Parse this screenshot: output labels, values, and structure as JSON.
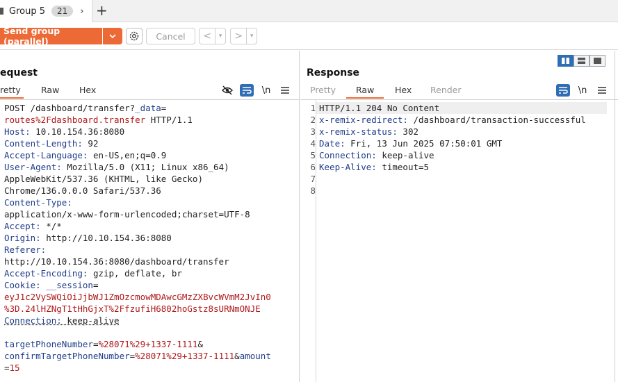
{
  "tabbar": {
    "tab_label": "Group 5",
    "tab_count": "21",
    "chevron": "›",
    "add": "+"
  },
  "toolbar": {
    "send_label": "Send group (parallel)",
    "send_dropdown": "⌄",
    "cancel_label": "Cancel",
    "prev": "<",
    "next": ">",
    "dropdown_glyph": "▾"
  },
  "request": {
    "title": "equest",
    "tabs": [
      "retty",
      "Raw",
      "Hex"
    ],
    "icons": [
      "eye-off-icon",
      "wrap-icon",
      "newline-icon",
      "menu-icon"
    ],
    "newline_label": "\\n",
    "lines": [
      [
        {
          "c": "v",
          "t": "POST /dashboard/transfer?"
        },
        {
          "c": "k",
          "t": "_data"
        },
        {
          "c": "v",
          "t": "="
        }
      ],
      [
        {
          "c": "red",
          "t": "routes%2Fdashboard.transfer"
        },
        {
          "c": "v",
          "t": " HTTP/1.1"
        }
      ],
      [
        {
          "c": "k",
          "t": "Host:"
        },
        {
          "c": "v",
          "t": " 10.10.154.36:8080"
        }
      ],
      [
        {
          "c": "k",
          "t": "Content-Length:"
        },
        {
          "c": "v",
          "t": " 92"
        }
      ],
      [
        {
          "c": "k",
          "t": "Accept-Language:"
        },
        {
          "c": "v",
          "t": " en-US,en;q=0.9"
        }
      ],
      [
        {
          "c": "k",
          "t": "User-Agent:"
        },
        {
          "c": "v",
          "t": " Mozilla/5.0 (X11; Linux x86_64)"
        }
      ],
      [
        {
          "c": "v",
          "t": "AppleWebKit/537.36 (KHTML, like Gecko)"
        }
      ],
      [
        {
          "c": "v",
          "t": "Chrome/136.0.0.0 Safari/537.36"
        }
      ],
      [
        {
          "c": "k",
          "t": "Content-Type:"
        }
      ],
      [
        {
          "c": "v",
          "t": "application/x-www-form-urlencoded;charset=UTF-8"
        }
      ],
      [
        {
          "c": "k",
          "t": "Accept:"
        },
        {
          "c": "v",
          "t": " */*"
        }
      ],
      [
        {
          "c": "k",
          "t": "Origin:"
        },
        {
          "c": "v",
          "t": " http://10.10.154.36:8080"
        }
      ],
      [
        {
          "c": "k",
          "t": "Referer:"
        }
      ],
      [
        {
          "c": "v",
          "t": "http://10.10.154.36:8080/dashboard/transfer"
        }
      ],
      [
        {
          "c": "k",
          "t": "Accept-Encoding:"
        },
        {
          "c": "v",
          "t": " gzip, deflate, br"
        }
      ],
      [
        {
          "c": "k",
          "t": "Cookie:"
        },
        {
          "c": "v",
          "t": " "
        },
        {
          "c": "k",
          "t": "__session"
        },
        {
          "c": "v",
          "t": "="
        }
      ],
      [
        {
          "c": "red",
          "t": "eyJ1c2VySWQiOiJjbWJ1ZmOzcmowMDAwcGMzZXBvcWVmM2JvIn0"
        }
      ],
      [
        {
          "c": "red",
          "t": "%3D.24lHZNgT1tHhGjxT%2FfzufiH6802hoGstz8sURNmONJE"
        }
      ],
      [
        {
          "c": "k",
          "t": "Connection:"
        },
        {
          "c": "v",
          "t": " keep-alive"
        }
      ],
      [
        {
          "c": "v",
          "t": ""
        }
      ],
      [
        {
          "c": "k",
          "t": "targetPhoneNumber"
        },
        {
          "c": "v",
          "t": "="
        },
        {
          "c": "red",
          "t": "%28071%29+1337-1111"
        },
        {
          "c": "v",
          "t": "&"
        }
      ],
      [
        {
          "c": "k",
          "t": "confirmTargetPhoneNumber"
        },
        {
          "c": "v",
          "t": "="
        },
        {
          "c": "red",
          "t": "%28071%29+1337-1111"
        },
        {
          "c": "v",
          "t": "&"
        },
        {
          "c": "k",
          "t": "amount"
        }
      ],
      [
        {
          "c": "v",
          "t": "="
        },
        {
          "c": "red",
          "t": "15"
        }
      ]
    ]
  },
  "response": {
    "title": "Response",
    "tabs": [
      "Pretty",
      "Raw",
      "Hex",
      "Render"
    ],
    "icons": [
      "wrap-icon",
      "newline-icon",
      "menu-icon"
    ],
    "newline_label": "\\n",
    "line_numbers": [
      "1",
      "2",
      "3",
      "4",
      "5",
      "6",
      "7",
      "8"
    ],
    "lines": [
      [
        {
          "c": "v",
          "t": "HTTP/1.1 204 No Content"
        }
      ],
      [
        {
          "c": "k",
          "t": "x-remix-redirect:"
        },
        {
          "c": "v",
          "t": " /dashboard/transaction-successful"
        }
      ],
      [
        {
          "c": "k",
          "t": "x-remix-status:"
        },
        {
          "c": "v",
          "t": " 302"
        }
      ],
      [
        {
          "c": "k",
          "t": "Date:"
        },
        {
          "c": "v",
          "t": " Fri, 13 Jun 2025 07:50:01 GMT"
        }
      ],
      [
        {
          "c": "k",
          "t": "Connection:"
        },
        {
          "c": "v",
          "t": " keep-alive"
        }
      ],
      [
        {
          "c": "k",
          "t": "Keep-Alive:"
        },
        {
          "c": "v",
          "t": " timeout=5"
        }
      ],
      [
        {
          "c": "v",
          "t": ""
        }
      ],
      [
        {
          "c": "v",
          "t": ""
        }
      ]
    ]
  },
  "view_layout_icons": [
    "split-horizontal-icon",
    "split-vertical-icon",
    "tabs-icon"
  ],
  "colors": {
    "accent": "#ed6a36",
    "selected": "#2f6db5",
    "header_key": "#1f3d8a",
    "value_red": "#b0181a"
  }
}
